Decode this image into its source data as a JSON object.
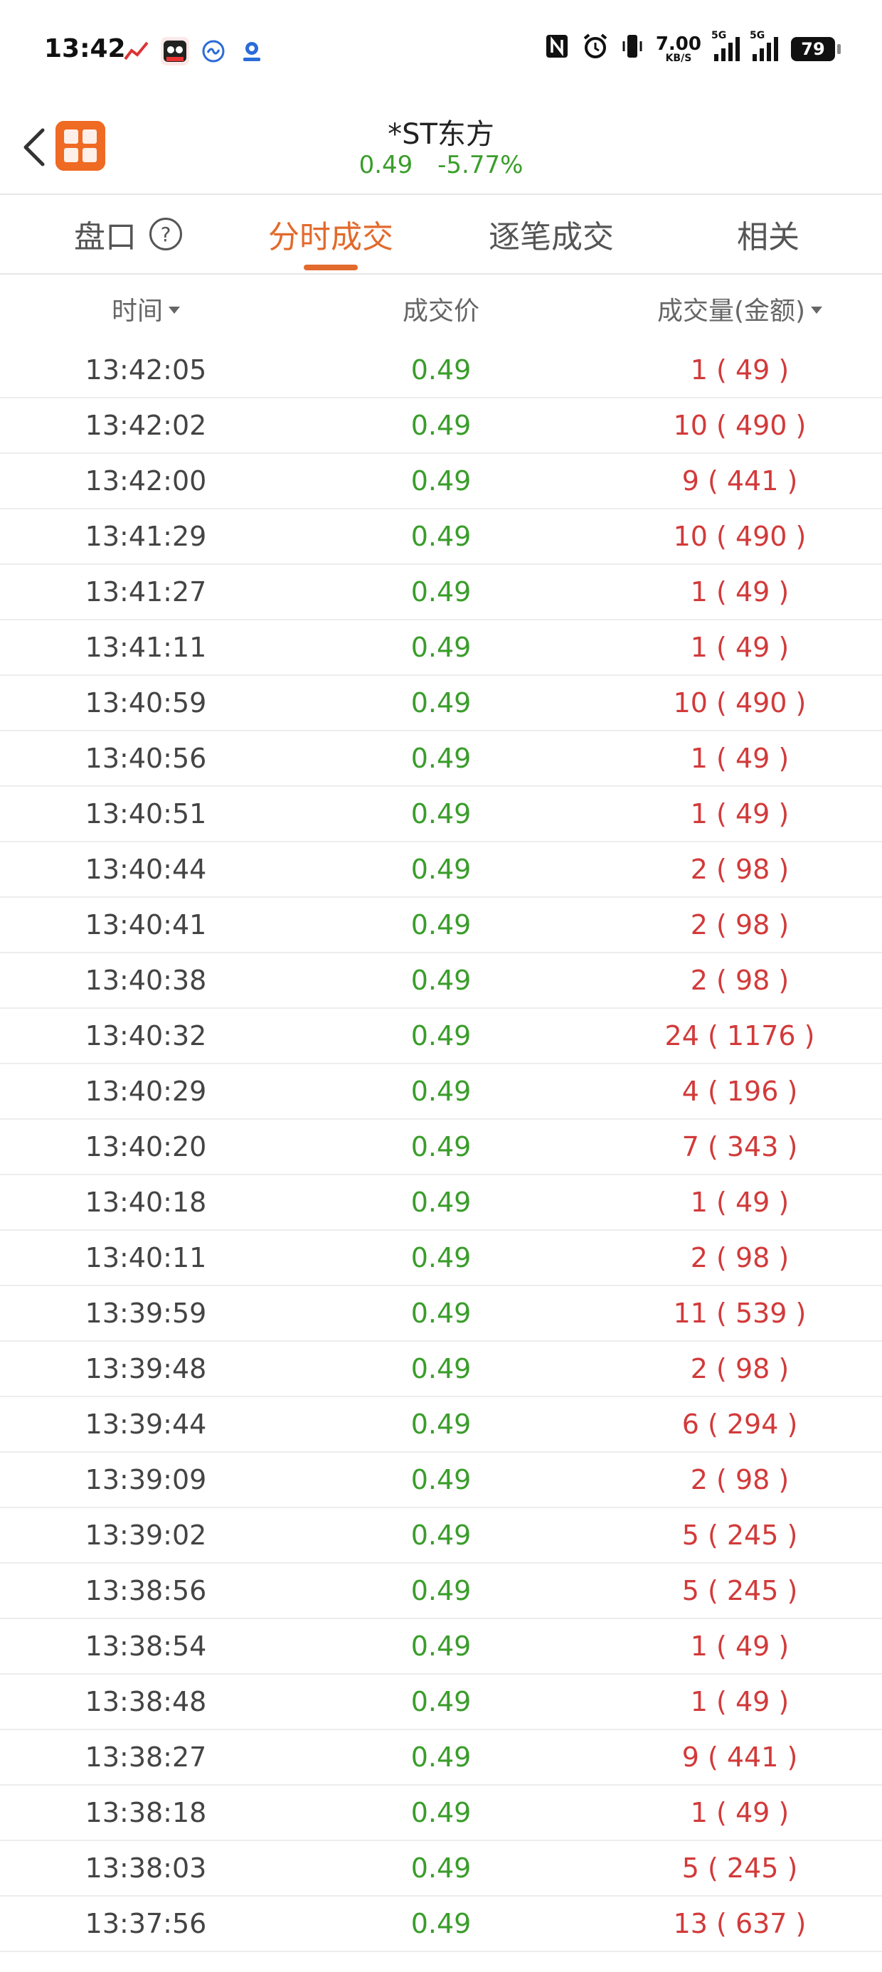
{
  "status_bar": {
    "time": "13:42",
    "net_speed_value": "7.00",
    "net_speed_unit": "KB/S",
    "signal1_tag": "5G",
    "signal2_tag": "5G",
    "battery": "79"
  },
  "header": {
    "logo_text": "东方财富",
    "stock_name": "*ST东方",
    "price": "0.49",
    "change_pct": "-5.77%"
  },
  "tabs": [
    {
      "label": "盘口",
      "active": false
    },
    {
      "label": "分时成交",
      "active": true
    },
    {
      "label": "逐笔成交",
      "active": false
    },
    {
      "label": "相关",
      "active": false
    }
  ],
  "columns": {
    "time": "时间",
    "price": "成交价",
    "volume": "成交量(金额)"
  },
  "colors": {
    "accent": "#e26a2c",
    "price_green": "#3a9d2b",
    "volume_red": "#d23a3a"
  },
  "trades": [
    {
      "time": "13:42:05",
      "price": "0.49",
      "volume": "1 ( 49 )"
    },
    {
      "time": "13:42:02",
      "price": "0.49",
      "volume": "10 ( 490 )"
    },
    {
      "time": "13:42:00",
      "price": "0.49",
      "volume": "9 ( 441 )"
    },
    {
      "time": "13:41:29",
      "price": "0.49",
      "volume": "10 ( 490 )"
    },
    {
      "time": "13:41:27",
      "price": "0.49",
      "volume": "1 ( 49 )"
    },
    {
      "time": "13:41:11",
      "price": "0.49",
      "volume": "1 ( 49 )"
    },
    {
      "time": "13:40:59",
      "price": "0.49",
      "volume": "10 ( 490 )"
    },
    {
      "time": "13:40:56",
      "price": "0.49",
      "volume": "1 ( 49 )"
    },
    {
      "time": "13:40:51",
      "price": "0.49",
      "volume": "1 ( 49 )"
    },
    {
      "time": "13:40:44",
      "price": "0.49",
      "volume": "2 ( 98 )"
    },
    {
      "time": "13:40:41",
      "price": "0.49",
      "volume": "2 ( 98 )"
    },
    {
      "time": "13:40:38",
      "price": "0.49",
      "volume": "2 ( 98 )"
    },
    {
      "time": "13:40:32",
      "price": "0.49",
      "volume": "24 ( 1176 )"
    },
    {
      "time": "13:40:29",
      "price": "0.49",
      "volume": "4 ( 196 )"
    },
    {
      "time": "13:40:20",
      "price": "0.49",
      "volume": "7 ( 343 )"
    },
    {
      "time": "13:40:18",
      "price": "0.49",
      "volume": "1 ( 49 )"
    },
    {
      "time": "13:40:11",
      "price": "0.49",
      "volume": "2 ( 98 )"
    },
    {
      "time": "13:39:59",
      "price": "0.49",
      "volume": "11 ( 539 )"
    },
    {
      "time": "13:39:48",
      "price": "0.49",
      "volume": "2 ( 98 )"
    },
    {
      "time": "13:39:44",
      "price": "0.49",
      "volume": "6 ( 294 )"
    },
    {
      "time": "13:39:09",
      "price": "0.49",
      "volume": "2 ( 98 )"
    },
    {
      "time": "13:39:02",
      "price": "0.49",
      "volume": "5 ( 245 )"
    },
    {
      "time": "13:38:56",
      "price": "0.49",
      "volume": "5 ( 245 )"
    },
    {
      "time": "13:38:54",
      "price": "0.49",
      "volume": "1 ( 49 )"
    },
    {
      "time": "13:38:48",
      "price": "0.49",
      "volume": "1 ( 49 )"
    },
    {
      "time": "13:38:27",
      "price": "0.49",
      "volume": "9 ( 441 )"
    },
    {
      "time": "13:38:18",
      "price": "0.49",
      "volume": "1 ( 49 )"
    },
    {
      "time": "13:38:03",
      "price": "0.49",
      "volume": "5 ( 245 )"
    },
    {
      "time": "13:37:56",
      "price": "0.49",
      "volume": "13 ( 637 )"
    }
  ]
}
